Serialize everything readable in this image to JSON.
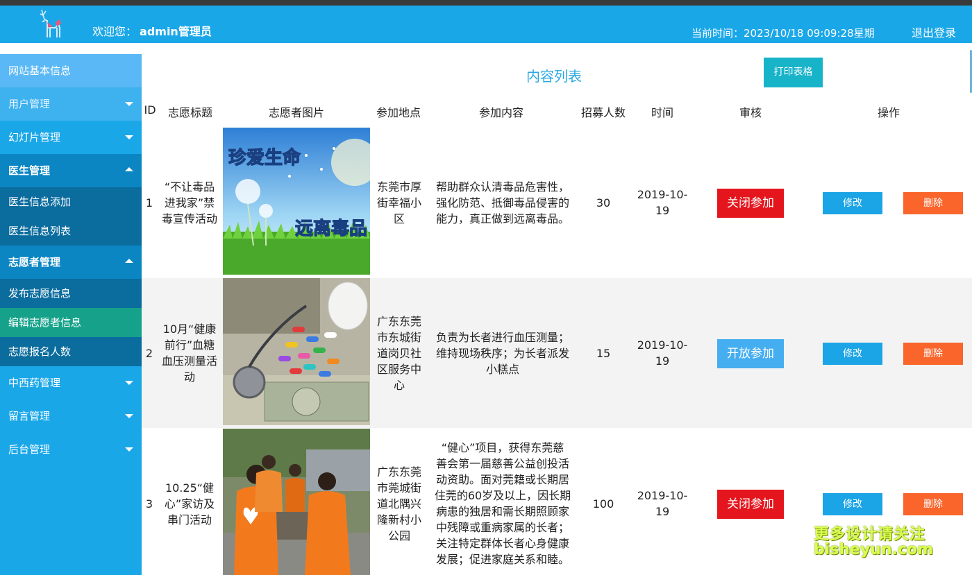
{
  "header": {
    "welcome_label": "欢迎您：",
    "username": "admin管理员",
    "time_label": "当前时间：",
    "time_value": "2023/10/18 09:09:28星期",
    "logout": "退出登录"
  },
  "sidebar": {
    "items": [
      {
        "label": "网站基本信息"
      },
      {
        "label": "用户管理"
      },
      {
        "label": "幻灯片管理"
      },
      {
        "label": "医生管理"
      },
      {
        "label": "医生信息添加"
      },
      {
        "label": "医生信息列表"
      },
      {
        "label": "志愿者管理"
      },
      {
        "label": "发布志愿信息"
      },
      {
        "label": "编辑志愿者信息"
      },
      {
        "label": "志愿报名人数"
      },
      {
        "label": "中西药管理"
      },
      {
        "label": "留言管理"
      },
      {
        "label": "后台管理"
      }
    ]
  },
  "main": {
    "title": "内容列表",
    "print_button": "打印表格",
    "columns": [
      "ID",
      "志愿标题",
      "志愿者图片",
      "参加地点",
      "参加内容",
      "招募人数",
      "时间",
      "审核",
      "操作"
    ],
    "rows": [
      {
        "id": "1",
        "title_lines": [
          "“不让毒品",
          "进我家”禁",
          "毒宣传活动"
        ],
        "image_text_top": "珍爱生命",
        "image_text_bottom": "远离毒品",
        "location_lines": [
          "东莞市厚",
          "街幸福小",
          "区"
        ],
        "content_lines": [
          "帮助群众认清毒品危害性，",
          "强化防范、抵御毒品侵害的",
          "能力，真正做到远离毒品。"
        ],
        "count": "30",
        "date_lines": [
          "2019-10-",
          "19"
        ],
        "audit": "关闭参加",
        "edit": "修改",
        "delete": "删除"
      },
      {
        "id": "2",
        "title_lines": [
          "10月“健康",
          "前行”血糖",
          "血压测量活",
          "动"
        ],
        "location_lines": [
          "广东东莞",
          "市东城街",
          "道岗贝社",
          "区服务中",
          "心"
        ],
        "content_lines": [
          "负责为长者进行血压测量；",
          "维持现场秩序；为长者派发",
          "小糕点"
        ],
        "count": "15",
        "date_lines": [
          "2019-10-",
          "19"
        ],
        "audit": "开放参加",
        "edit": "修改",
        "delete": "删除"
      },
      {
        "id": "3",
        "title_lines": [
          "10.25“健",
          "心”家访及",
          "串门活动"
        ],
        "location_lines": [
          "广东东莞",
          "市莞城街",
          "道北隅兴",
          "隆新村小",
          "公园"
        ],
        "content_lines": [
          "“健心”项目，获得东莞慈",
          "善会第一届慈善公益创投活",
          "动资助。面对莞籍或长期居",
          "住莞的60岁及以上，因长期",
          "病患的独居和需长期照顾家",
          "中残障或重病家属的长者；",
          "关注特定群体长者心身健康",
          "发展；促进家庭关系和睦。"
        ],
        "count": "100",
        "date_lines": [
          "2019-10-",
          "19"
        ],
        "audit": "关闭参加",
        "edit": "修改",
        "delete": "删除"
      }
    ]
  },
  "watermark": {
    "line1": "更多设计请关注",
    "line2": "bisheyun.com"
  },
  "colors": {
    "header_bg": "#1aa7e8",
    "sidebar_bg": "#1aa7e8",
    "submenu_bg": "#0b6c9e",
    "active_submenu": "#16a28a",
    "audit_close": "#e4151d",
    "audit_open": "#45aef0",
    "edit_btn": "#1ba4e6",
    "delete_btn": "#f9652b"
  },
  "icons": {
    "logo": "deer-logo-icon",
    "collapsed": "caret-down-icon",
    "expanded": "caret-up-icon"
  }
}
